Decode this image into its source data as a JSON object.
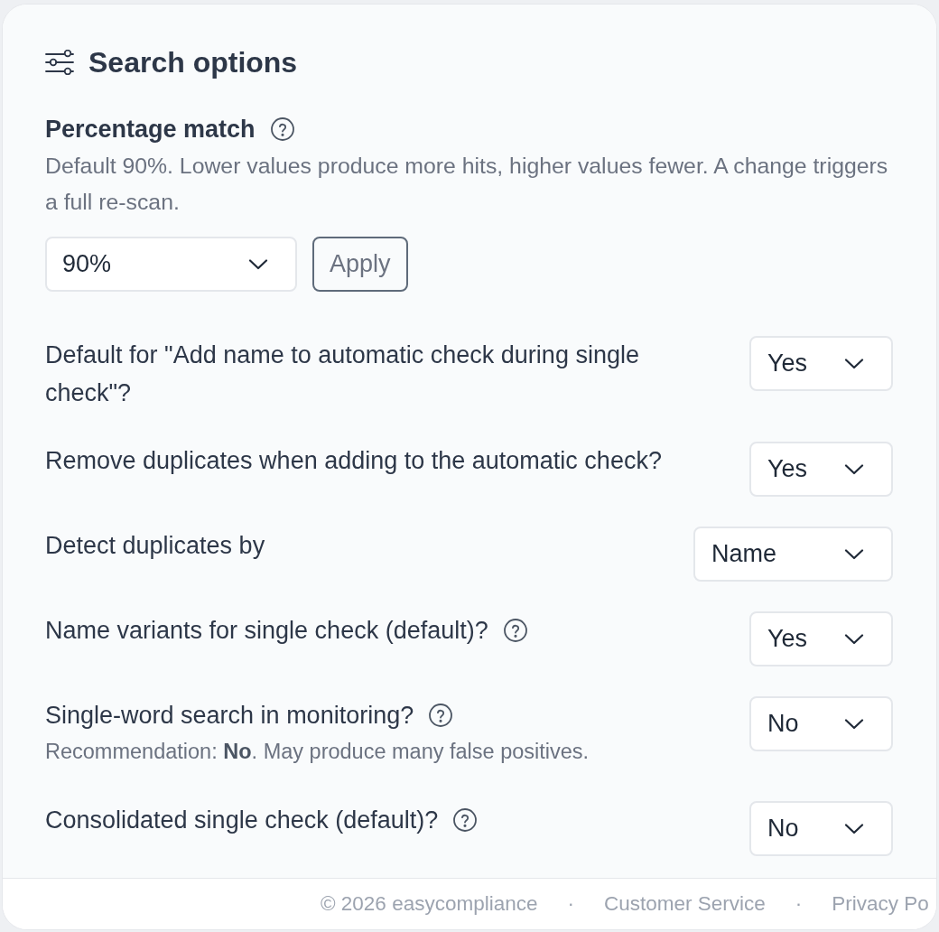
{
  "header": {
    "title": "Search options"
  },
  "percentage_match": {
    "label": "Percentage match",
    "help": true,
    "description": "Default 90%. Lower values produce more hits, higher values fewer. A change triggers a full re-scan.",
    "select": {
      "value": "90%"
    },
    "apply_button": {
      "label": "Apply"
    }
  },
  "settings": [
    {
      "label": "Default for \"Add name to automatic check during single check\"?",
      "help": false,
      "value": "Yes"
    },
    {
      "label": "Remove duplicates when adding to the automatic check?",
      "help": false,
      "value": "Yes"
    },
    {
      "label": "Detect duplicates by",
      "help": false,
      "value": "Name"
    },
    {
      "label": "Name variants for single check (default)?",
      "help": true,
      "value": "Yes"
    },
    {
      "label": "Single-word search in monitoring?",
      "help": true,
      "note": "Recommendation: **No**. May produce many false positives.",
      "value": "No"
    },
    {
      "label": "Consolidated single check (default)?",
      "help": true,
      "value": "No"
    }
  ],
  "footer": {
    "copyright": "© 2026 easycompliance",
    "links": [
      {
        "separator": "·",
        "label": "Customer Service"
      },
      {
        "separator": "·",
        "label": "Privacy Po"
      }
    ]
  }
}
